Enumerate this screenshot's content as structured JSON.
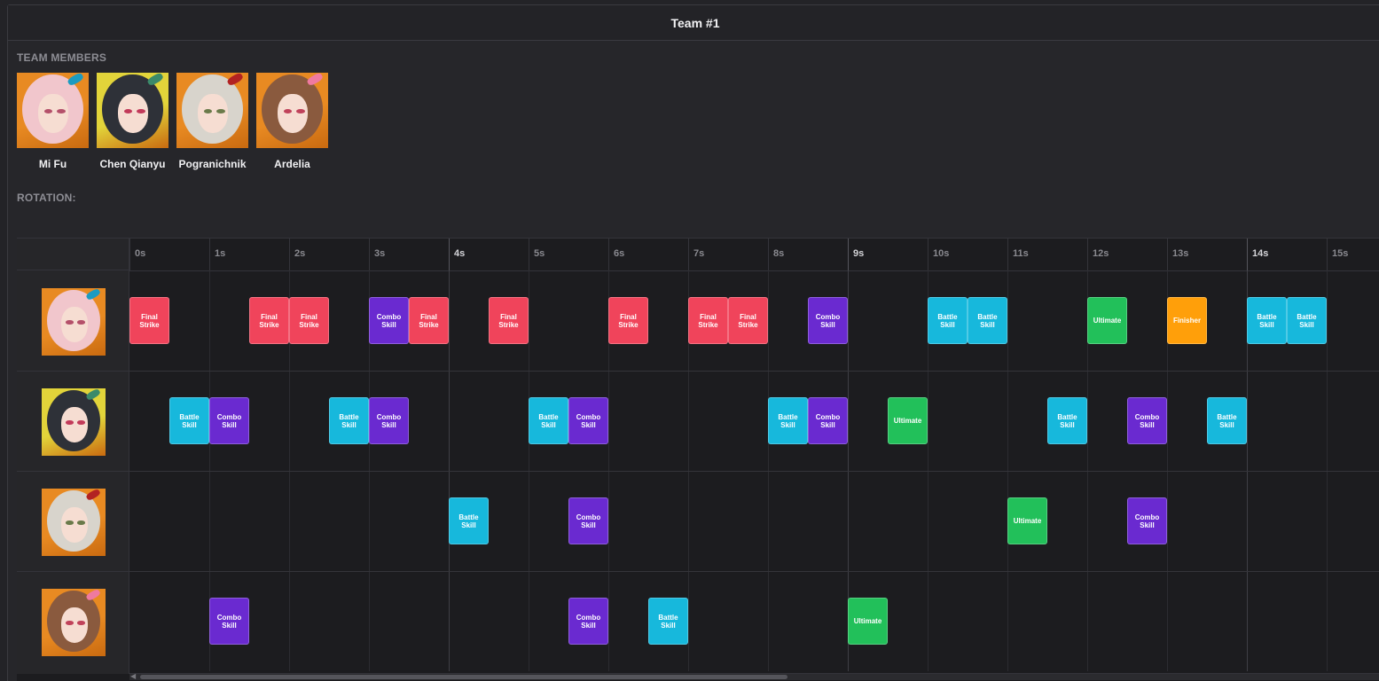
{
  "panel": {
    "title": "Team #1"
  },
  "sections": {
    "team_members": "TEAM MEMBERS",
    "rotation": "ROTATION:"
  },
  "members": [
    {
      "name": "Mi Fu",
      "bg": "#e88a22",
      "hair": "#f1c6cc",
      "eye": "#b4506a",
      "accent": "#1c9bc0"
    },
    {
      "name": "Chen Qianyu",
      "bg": "#e2d43a",
      "hair": "#2e3138",
      "eye": "#c23a5a",
      "accent": "#3b8a6a"
    },
    {
      "name": "Pogranichnik",
      "bg": "#e88a22",
      "hair": "#d8d4cc",
      "eye": "#6a7a4a",
      "accent": "#b22222"
    },
    {
      "name": "Ardelia",
      "bg": "#e88a22",
      "hair": "#8a5a3e",
      "eye": "#c0425a",
      "accent": "#ef7aa0"
    }
  ],
  "timeline": {
    "ticks": [
      "0s",
      "1s",
      "2s",
      "3s",
      "4s",
      "5s",
      "6s",
      "7s",
      "8s",
      "9s",
      "10s",
      "11s",
      "12s",
      "13s",
      "14s",
      "15s"
    ],
    "major_ticks": [
      4,
      9,
      14
    ],
    "skill_colors": {
      "Final Strike": "#f0445b",
      "Battle Skill": "#17b8dc",
      "Combo Skill": "#6a2ad0",
      "Ultimate": "#22c05a",
      "Finisher": "#ff9f0a"
    },
    "rows": [
      {
        "member": "Mi Fu",
        "skills": [
          {
            "t": 0,
            "label": "Final\nStrike",
            "type": "Final Strike"
          },
          {
            "t": 1.5,
            "label": "Final\nStrike",
            "type": "Final Strike"
          },
          {
            "t": 2,
            "label": "Final\nStrike",
            "type": "Final Strike"
          },
          {
            "t": 3,
            "label": "Combo\nSkill",
            "type": "Combo Skill"
          },
          {
            "t": 3.5,
            "label": "Final\nStrike",
            "type": "Final Strike"
          },
          {
            "t": 4.5,
            "label": "Final\nStrike",
            "type": "Final Strike"
          },
          {
            "t": 6,
            "label": "Final\nStrike",
            "type": "Final Strike"
          },
          {
            "t": 7,
            "label": "Final\nStrike",
            "type": "Final Strike"
          },
          {
            "t": 7.5,
            "label": "Final\nStrike",
            "type": "Final Strike"
          },
          {
            "t": 8.5,
            "label": "Combo\nSkill",
            "type": "Combo Skill"
          },
          {
            "t": 10,
            "label": "Battle\nSkill",
            "type": "Battle Skill"
          },
          {
            "t": 10.5,
            "label": "Battle\nSkill",
            "type": "Battle Skill"
          },
          {
            "t": 12,
            "label": "Ultimate",
            "type": "Ultimate"
          },
          {
            "t": 13,
            "label": "Finisher",
            "type": "Finisher"
          },
          {
            "t": 14,
            "label": "Battle\nSkill",
            "type": "Battle Skill"
          },
          {
            "t": 14.5,
            "label": "Battle\nSkill",
            "type": "Battle Skill"
          }
        ]
      },
      {
        "member": "Chen Qianyu",
        "skills": [
          {
            "t": 0.5,
            "label": "Battle\nSkill",
            "type": "Battle Skill"
          },
          {
            "t": 1,
            "label": "Combo\nSkill",
            "type": "Combo Skill"
          },
          {
            "t": 2.5,
            "label": "Battle\nSkill",
            "type": "Battle Skill"
          },
          {
            "t": 3,
            "label": "Combo\nSkill",
            "type": "Combo Skill"
          },
          {
            "t": 5,
            "label": "Battle\nSkill",
            "type": "Battle Skill"
          },
          {
            "t": 5.5,
            "label": "Combo\nSkill",
            "type": "Combo Skill"
          },
          {
            "t": 8,
            "label": "Battle\nSkill",
            "type": "Battle Skill"
          },
          {
            "t": 8.5,
            "label": "Combo\nSkill",
            "type": "Combo Skill"
          },
          {
            "t": 9.5,
            "label": "Ultimate",
            "type": "Ultimate"
          },
          {
            "t": 11.5,
            "label": "Battle\nSkill",
            "type": "Battle Skill"
          },
          {
            "t": 12.5,
            "label": "Combo\nSkill",
            "type": "Combo Skill"
          },
          {
            "t": 13.5,
            "label": "Battle\nSkill",
            "type": "Battle Skill"
          }
        ]
      },
      {
        "member": "Pogranichnik",
        "skills": [
          {
            "t": 4,
            "label": "Battle\nSkill",
            "type": "Battle Skill"
          },
          {
            "t": 5.5,
            "label": "Combo\nSkill",
            "type": "Combo Skill"
          },
          {
            "t": 11,
            "label": "Ultimate",
            "type": "Ultimate"
          },
          {
            "t": 12.5,
            "label": "Combo\nSkill",
            "type": "Combo Skill"
          }
        ]
      },
      {
        "member": "Ardelia",
        "skills": [
          {
            "t": 1,
            "label": "Combo\nSkill",
            "type": "Combo Skill"
          },
          {
            "t": 5.5,
            "label": "Combo\nSkill",
            "type": "Combo Skill"
          },
          {
            "t": 6.5,
            "label": "Battle\nSkill",
            "type": "Battle Skill"
          },
          {
            "t": 9,
            "label": "Ultimate",
            "type": "Ultimate"
          }
        ]
      }
    ]
  }
}
